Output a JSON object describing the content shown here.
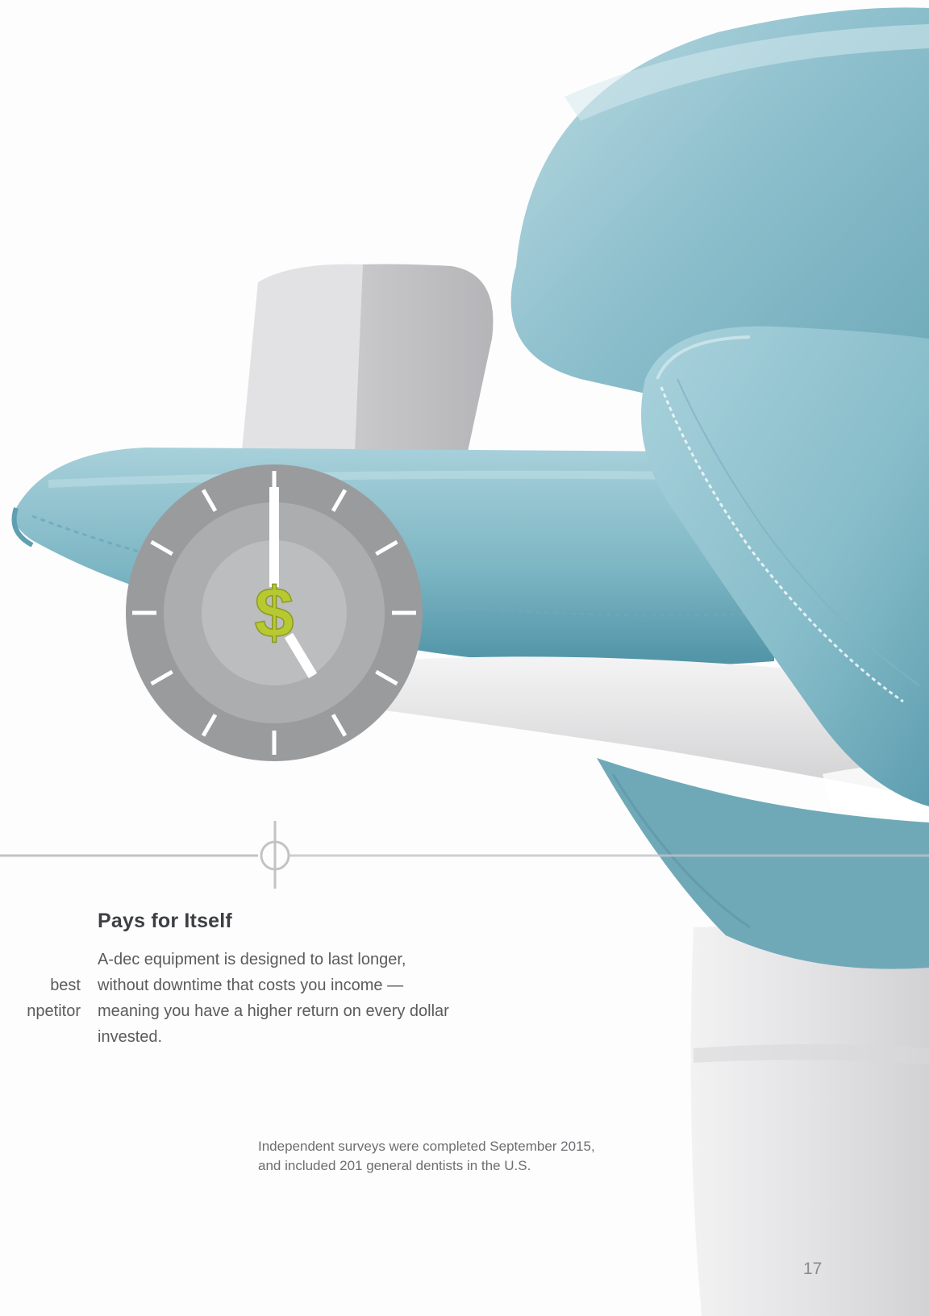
{
  "article": {
    "heading": "Pays for Itself",
    "body": "A-dec equipment is designed to last longer, without downtime that costs you income — meaning you have a higher return on every dollar invested.",
    "clipped_lines": [
      "best",
      "npetitor"
    ]
  },
  "footnote": {
    "line1": "Independent surveys were completed September 2015,",
    "line2": "and included 201 general dentists in the U.S."
  },
  "page_number": "17",
  "icon": {
    "name": "clock-dollar-icon",
    "glyph": "$",
    "colors": {
      "outer_ring": "#9a9b9d",
      "middle_ring": "#acadaf",
      "inner_disc": "#bcbdbf",
      "hands": "#ffffff",
      "dollar": "#b7c931"
    }
  },
  "colors": {
    "upholstery": "#7fb3c2",
    "upholstery_light": "#a9cfd9",
    "frame": "#e4e4e6",
    "divider": "#c2c3c5",
    "text": "#58595b"
  }
}
